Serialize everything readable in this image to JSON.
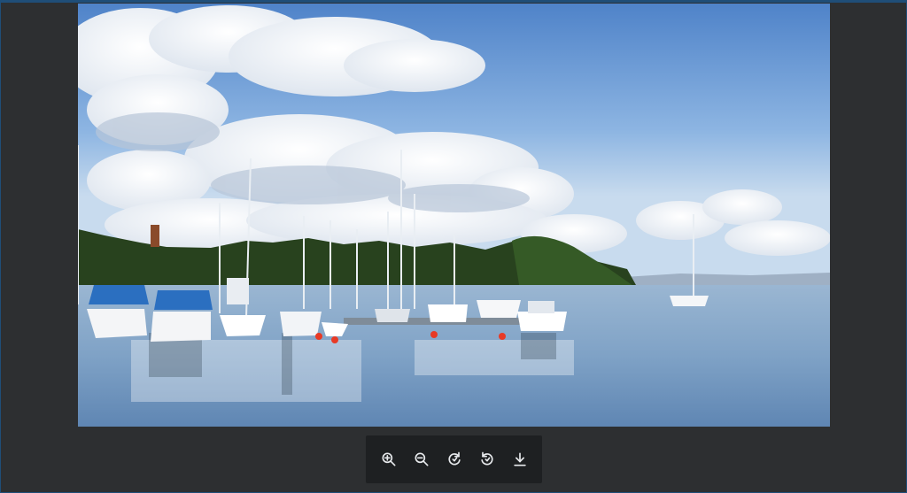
{
  "viewer": {
    "image_description_name": "harbor-photo"
  },
  "toolbar": {
    "buttons": [
      {
        "icon": "zoom-in-icon",
        "name": "zoom-in-button"
      },
      {
        "icon": "zoom-out-icon",
        "name": "zoom-out-button"
      },
      {
        "icon": "rotate-right-icon",
        "name": "rotate-right-button"
      },
      {
        "icon": "rotate-left-icon",
        "name": "rotate-left-button"
      },
      {
        "icon": "download-icon",
        "name": "download-button"
      }
    ]
  },
  "colors": {
    "background": "#2d2f31",
    "toolbar": "#1e2022",
    "icon": "#e8eaed",
    "border": "#1f4e78"
  }
}
